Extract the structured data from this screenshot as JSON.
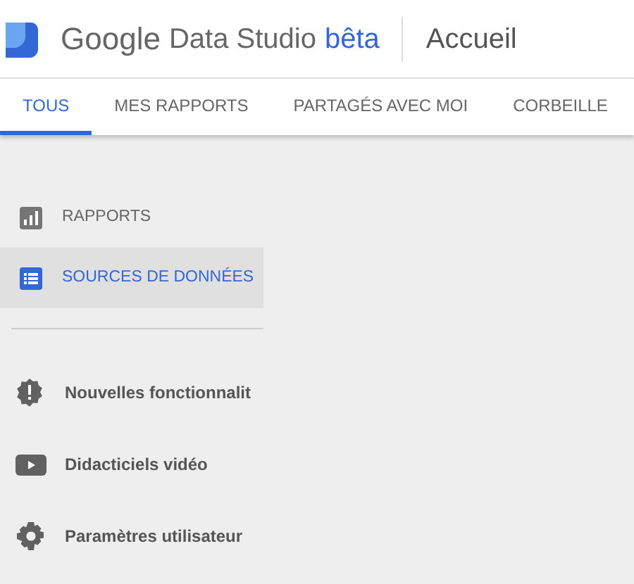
{
  "header": {
    "brand": "Google",
    "product": "Data Studio",
    "badge": "bêta",
    "page_title": "Accueil"
  },
  "tabs": [
    {
      "label": "TOUS",
      "selected": true
    },
    {
      "label": "MES RAPPORTS",
      "selected": false
    },
    {
      "label": "PARTAGÉS AVEC MOI",
      "selected": false
    },
    {
      "label": "CORBEILLE",
      "selected": false
    }
  ],
  "sidebar": {
    "nav": [
      {
        "label": "RAPPORTS",
        "selected": false
      },
      {
        "label": "SOURCES DE DONNÉES",
        "selected": true
      }
    ],
    "links": [
      {
        "label": "Nouvelles fonctionnalit"
      },
      {
        "label": "Didacticiels vidéo"
      },
      {
        "label": "Paramètres utilisateur"
      }
    ]
  }
}
